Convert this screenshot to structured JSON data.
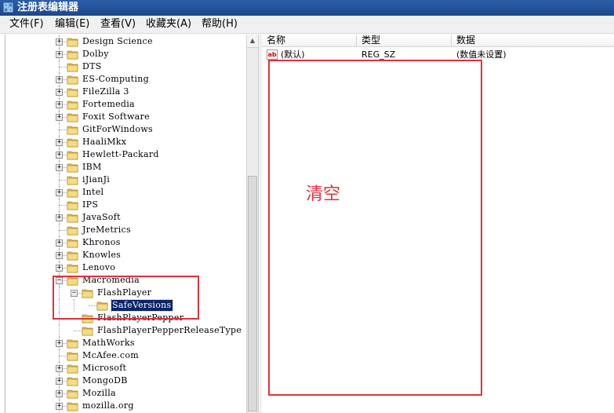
{
  "window": {
    "title": "注册表编辑器",
    "icon": "registry-editor-icon"
  },
  "menu": [
    "文件(F)",
    "编辑(E)",
    "查看(V)",
    "收藏夹(A)",
    "帮助(H)"
  ],
  "tree": [
    {
      "label": "Design Science",
      "expandable": true,
      "expanded": false,
      "level": 0
    },
    {
      "label": "Dolby",
      "expandable": true,
      "expanded": false,
      "level": 0
    },
    {
      "label": "DTS",
      "expandable": false,
      "level": 0
    },
    {
      "label": "ES-Computing",
      "expandable": true,
      "expanded": false,
      "level": 0
    },
    {
      "label": "FileZilla 3",
      "expandable": true,
      "expanded": false,
      "level": 0
    },
    {
      "label": "Fortemedia",
      "expandable": true,
      "expanded": false,
      "level": 0
    },
    {
      "label": "Foxit Software",
      "expandable": true,
      "expanded": false,
      "level": 0
    },
    {
      "label": "GitForWindows",
      "expandable": false,
      "level": 0
    },
    {
      "label": "HaaliMkx",
      "expandable": true,
      "expanded": false,
      "level": 0
    },
    {
      "label": "Hewlett-Packard",
      "expandable": true,
      "expanded": false,
      "level": 0
    },
    {
      "label": "IBM",
      "expandable": true,
      "expanded": false,
      "level": 0
    },
    {
      "label": "iJianJi",
      "expandable": false,
      "level": 0
    },
    {
      "label": "Intel",
      "expandable": true,
      "expanded": false,
      "level": 0
    },
    {
      "label": "IPS",
      "expandable": false,
      "level": 0
    },
    {
      "label": "JavaSoft",
      "expandable": true,
      "expanded": false,
      "level": 0
    },
    {
      "label": "JreMetrics",
      "expandable": false,
      "level": 0
    },
    {
      "label": "Khronos",
      "expandable": true,
      "expanded": false,
      "level": 0
    },
    {
      "label": "Knowles",
      "expandable": true,
      "expanded": false,
      "level": 0
    },
    {
      "label": "Lenovo",
      "expandable": true,
      "expanded": false,
      "level": 0
    },
    {
      "label": "Macromedia",
      "expandable": true,
      "expanded": true,
      "level": 0
    },
    {
      "label": "FlashPlayer",
      "expandable": true,
      "expanded": true,
      "level": 1
    },
    {
      "label": "SafeVersions",
      "expandable": false,
      "level": 2,
      "selected": true
    },
    {
      "label": "FlashPlayerPepper",
      "expandable": false,
      "level": 1
    },
    {
      "label": "FlashPlayerPepperReleaseType",
      "expandable": false,
      "level": 1
    },
    {
      "label": "MathWorks",
      "expandable": true,
      "expanded": false,
      "level": 0
    },
    {
      "label": "McAfee.com",
      "expandable": false,
      "level": 0
    },
    {
      "label": "Microsoft",
      "expandable": true,
      "expanded": false,
      "level": 0
    },
    {
      "label": "MongoDB",
      "expandable": true,
      "expanded": false,
      "level": 0
    },
    {
      "label": "Mozilla",
      "expandable": true,
      "expanded": false,
      "level": 0
    },
    {
      "label": "mozilla.org",
      "expandable": true,
      "expanded": false,
      "level": 0
    }
  ],
  "columns": [
    "名称",
    "类型",
    "数据"
  ],
  "values": [
    {
      "name": "(默认)",
      "type": "REG_SZ",
      "data": "(数值未设置)",
      "icon": "string-value-icon"
    }
  ],
  "annotation": {
    "text": "清空",
    "color": "#e0323a"
  },
  "colors": {
    "titlebar": "#2b5ea8",
    "selection": "#0a246a",
    "folder": "#e8c25a"
  }
}
